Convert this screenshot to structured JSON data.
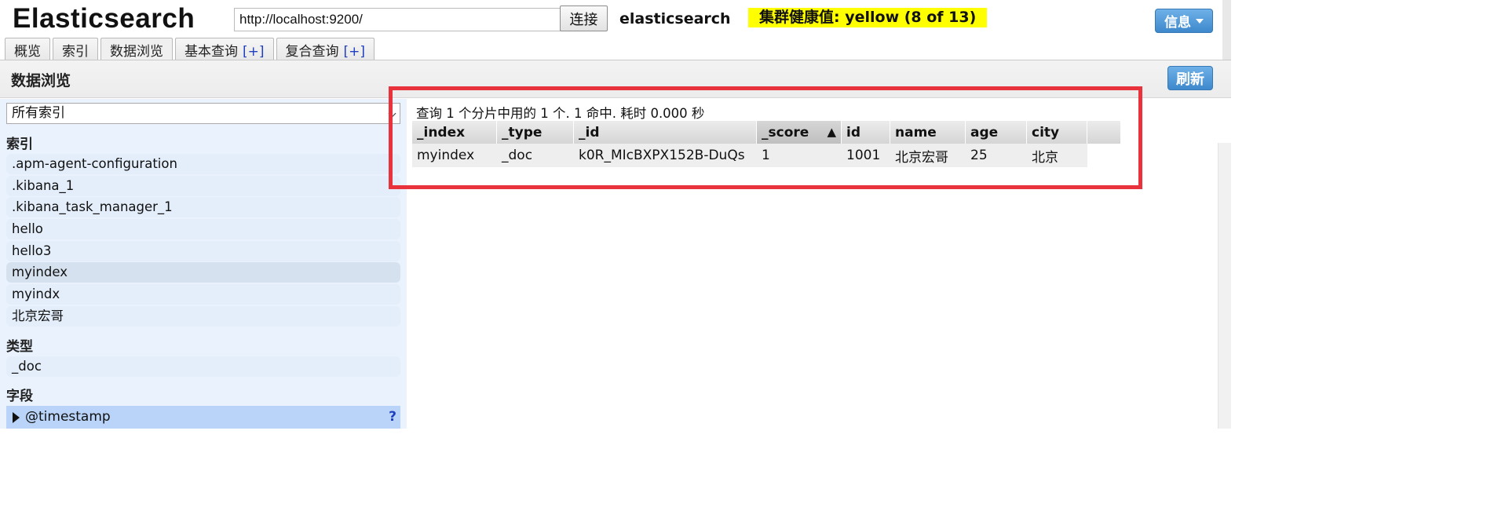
{
  "header": {
    "title": "Elasticsearch",
    "url_value": "http://localhost:9200/",
    "connect_label": "连接",
    "cluster_name": "elasticsearch",
    "health_text": "集群健康值: yellow (8 of 13)",
    "info_label": "信息"
  },
  "tabs": [
    {
      "label": "概览",
      "plus": ""
    },
    {
      "label": "索引",
      "plus": ""
    },
    {
      "label": "数据浏览",
      "plus": ""
    },
    {
      "label": "基本查询",
      "plus": "[+]"
    },
    {
      "label": "复合查询",
      "plus": "[+]"
    }
  ],
  "toolbar": {
    "title": "数据浏览",
    "refresh_label": "刷新"
  },
  "sidebar": {
    "selected_index_option": "所有索引",
    "indices_heading": "索引",
    "indices": [
      ".apm-agent-configuration",
      ".kibana_1",
      ".kibana_task_manager_1",
      "hello",
      "hello3",
      "myindex",
      "myindx",
      "北京宏哥"
    ],
    "types_heading": "类型",
    "types": [
      "_doc"
    ],
    "fields_heading": "字段",
    "fields": [
      "@timestamp"
    ],
    "help_label": "?"
  },
  "results": {
    "summary": "查询 1 个分片中用的 1 个. 1 命中. 耗时 0.000 秒",
    "columns": [
      "_index",
      "_type",
      "_id",
      "_score",
      "id",
      "name",
      "age",
      "city"
    ],
    "sort_marker": "▲",
    "rows": [
      [
        "myindex",
        "_doc",
        "k0R_MIcBXPX152B-DuQs",
        "1",
        "1001",
        "北京宏哥",
        "25",
        "北京"
      ]
    ]
  },
  "colors": {
    "health": "#ffff00",
    "button_blue": "#3d88cc",
    "highlight": "#e8333c",
    "sidebar_bg": "#e9f2fd"
  }
}
